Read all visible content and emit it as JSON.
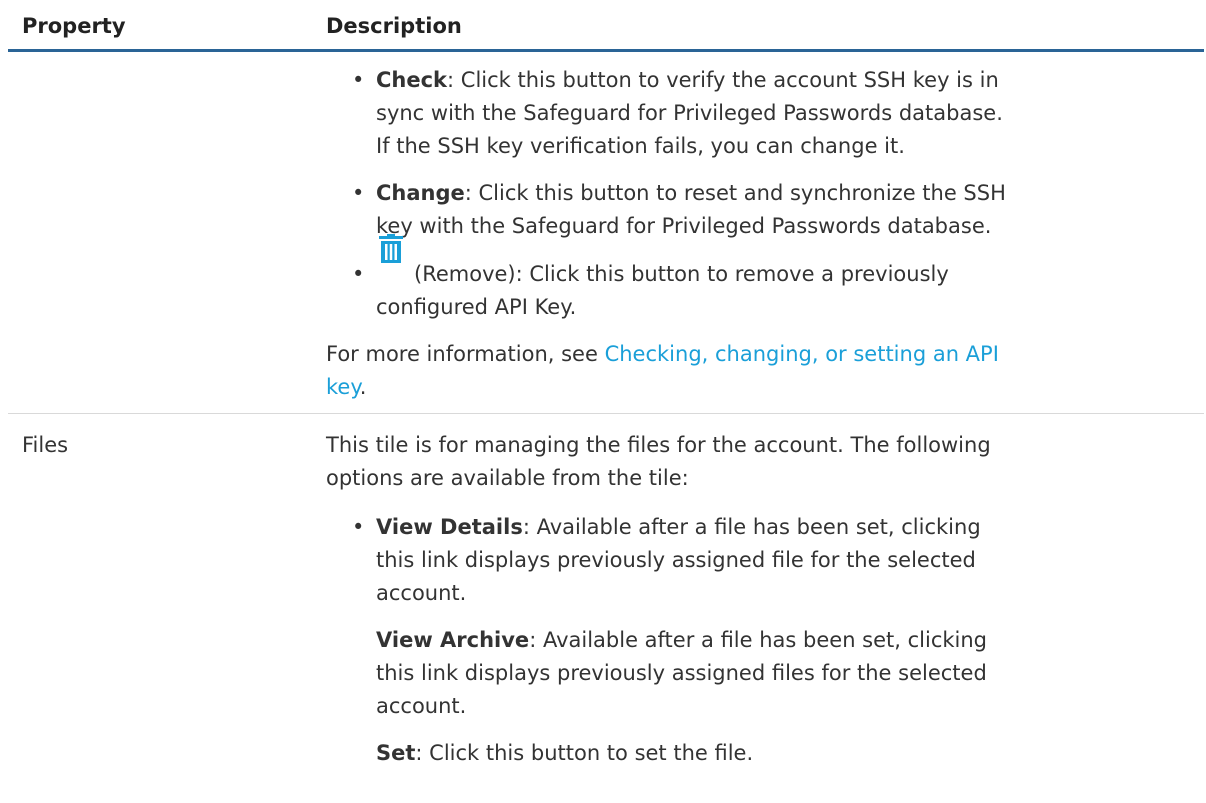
{
  "header": {
    "property_label": "Property",
    "description_label": "Description"
  },
  "ssh_section": {
    "check": {
      "term": "Check",
      "line1": ": Click this button to verify the account SSH key is in",
      "line2": "sync with the Safeguard for Privileged Passwords database.",
      "line3": "If the SSH key verification fails, you can change it."
    },
    "change": {
      "term": "Change",
      "line1": ": Click this button to reset and synchronize the SSH",
      "line2": "key with the Safeguard for Privileged Passwords database."
    },
    "remove": {
      "icon": "trash-icon",
      "line1": "(Remove): Click this button to remove a previously",
      "line2": "configured API Key."
    },
    "more_info_prefix": "For more information, see ",
    "more_info_link_line1": "Checking, changing, or setting an API",
    "more_info_link_line2": "key",
    "more_info_suffix": "."
  },
  "files_row": {
    "property": "Files",
    "intro_line1": "This tile is for managing the files for the account. The following",
    "intro_line2": "options are available from the tile:",
    "view_details": {
      "term": "View Details",
      "line1": ": Available after a file has been set, clicking",
      "line2": "this link displays previously assigned file for the selected",
      "line3": "account."
    },
    "view_archive": {
      "term": "View Archive",
      "line1": ": Available after a file has been set, clicking",
      "line2": "this link displays previously assigned files for the selected",
      "line3": "account."
    },
    "set": {
      "term": "Set",
      "line1": ": Click this button to set the file."
    }
  },
  "colors": {
    "header_rule": "#2a6496",
    "link": "#1a9fd8",
    "icon": "#1a9fd8",
    "divider": "#d9d9d9"
  }
}
